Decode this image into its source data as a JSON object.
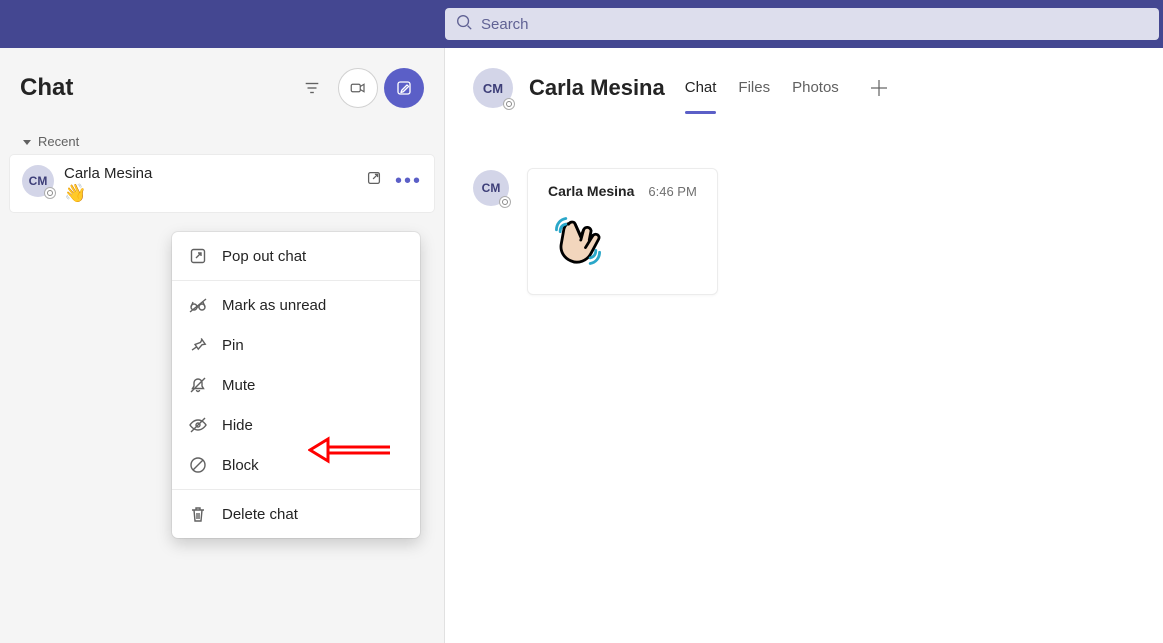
{
  "search": {
    "placeholder": "Search"
  },
  "left": {
    "title": "Chat",
    "section": "Recent",
    "item": {
      "initials": "CM",
      "name": "Carla Mesina",
      "preview_emoji": "👋"
    }
  },
  "menu": {
    "popout": "Pop out chat",
    "unread": "Mark as unread",
    "pin": "Pin",
    "mute": "Mute",
    "hide": "Hide",
    "block": "Block",
    "delete": "Delete chat"
  },
  "conv": {
    "initials": "CM",
    "name": "Carla Mesina",
    "tabs": {
      "chat": "Chat",
      "files": "Files",
      "photos": "Photos"
    },
    "msg": {
      "author": "Carla Mesina",
      "time": "6:46 PM"
    }
  }
}
